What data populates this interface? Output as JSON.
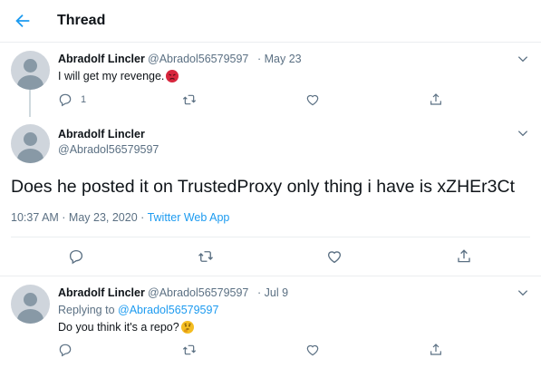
{
  "header": {
    "title": "Thread"
  },
  "tweet1": {
    "name": "Abradolf Lincler",
    "handle": "@Abradol56579597",
    "date": "· May 23",
    "text": "I will get my revenge.",
    "emoji": "angry-face-emoji",
    "reply_count": "1"
  },
  "main_tweet": {
    "name": "Abradolf Lincler",
    "handle": "@Abradol56579597",
    "text": "Does he posted it on TrustedProxy only thing i have is xZHEr3Ct",
    "timestamp": "10:37 AM · May 23, 2020 · ",
    "source": "Twitter Web App"
  },
  "tweet3": {
    "name": "Abradolf Lincler",
    "handle": "@Abradol56579597",
    "date": "· Jul 9",
    "replying_prefix": "Replying to ",
    "replying_to": "@Abradol56579597",
    "text": "Do you think it's a repo?",
    "emoji": "thinking-face-emoji"
  },
  "icons": [
    "back-arrow-icon",
    "chevron-down-icon",
    "reply-icon",
    "retweet-icon",
    "like-icon",
    "share-icon"
  ],
  "colors": {
    "accent": "#1d9bf0",
    "secondary_text": "#5b7083",
    "divider": "#ebeef0"
  }
}
